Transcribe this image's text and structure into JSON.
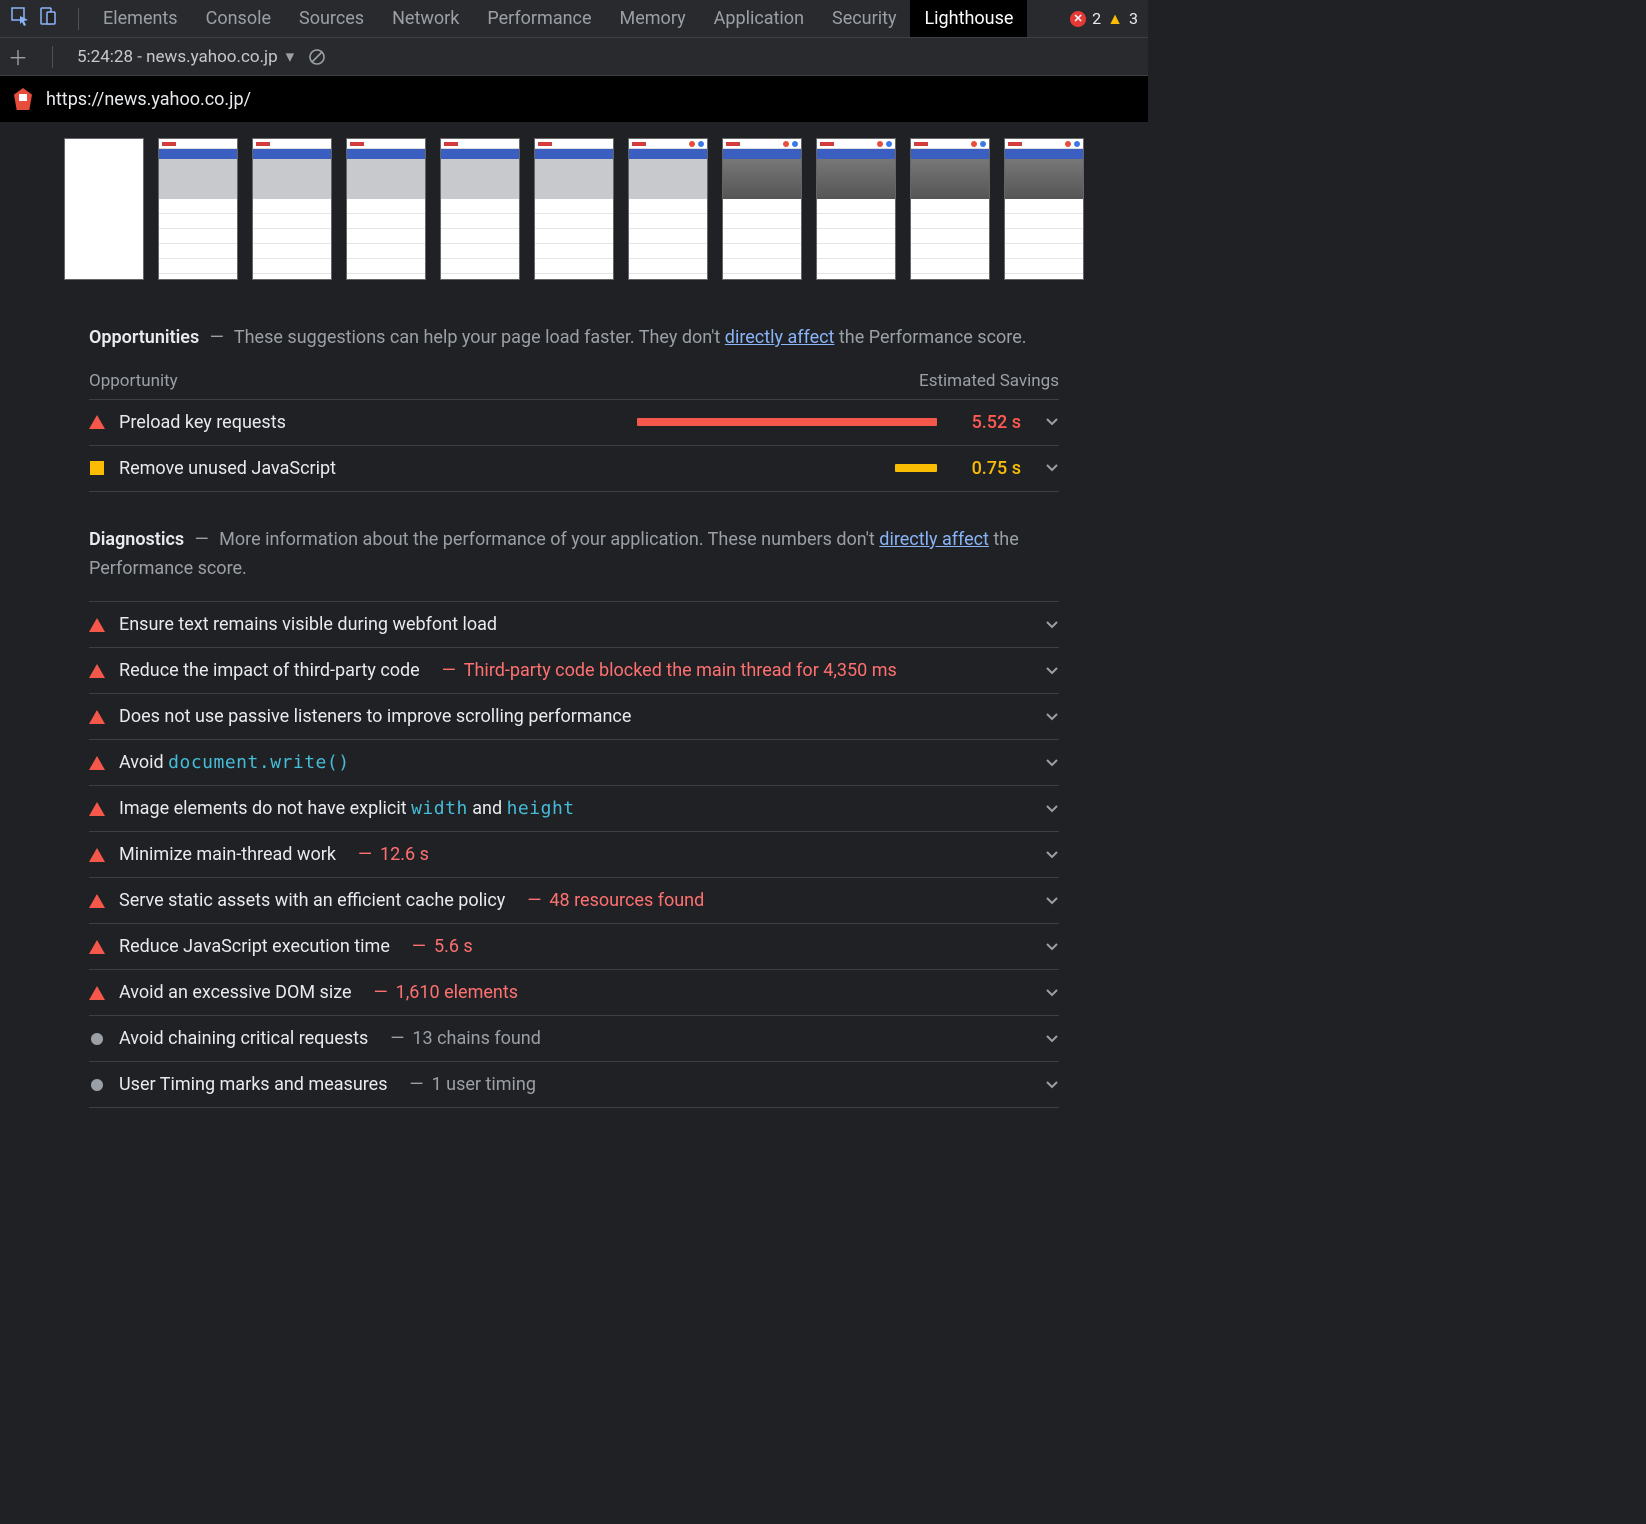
{
  "tabs": [
    "Elements",
    "Console",
    "Sources",
    "Network",
    "Performance",
    "Memory",
    "Application",
    "Security",
    "Lighthouse"
  ],
  "active_tab": "Lighthouse",
  "status": {
    "errors": "2",
    "warnings": "3"
  },
  "run": {
    "label": "5:24:28 - news.yahoo.co.jp"
  },
  "url": "https://news.yahoo.co.jp/",
  "opportunities": {
    "title": "Opportunities",
    "desc_pre": "These suggestions can help your page load faster. They don't ",
    "desc_link": "directly affect",
    "desc_post": " the Performance score.",
    "col1": "Opportunity",
    "col2": "Estimated Savings",
    "items": [
      {
        "sev": "red",
        "title": "Preload key requests",
        "bar_pct": 100,
        "val": "5.52 s"
      },
      {
        "sev": "yellow",
        "title": "Remove unused JavaScript",
        "bar_pct": 14,
        "val": "0.75 s"
      }
    ]
  },
  "diagnostics": {
    "title": "Diagnostics",
    "desc_pre": "More information about the performance of your application. These numbers don't ",
    "desc_link": "directly affect",
    "desc_post": " the Performance score.",
    "items": [
      {
        "sev": "red",
        "title": "Ensure text remains visible during webfont load"
      },
      {
        "sev": "red",
        "title": "Reduce the impact of third-party code",
        "detail": "Third-party code blocked the main thread for 4,350 ms",
        "detail_kind": "red"
      },
      {
        "sev": "red",
        "title": "Does not use passive listeners to improve scrolling performance"
      },
      {
        "sev": "red",
        "title_pre": "Avoid ",
        "code": "document.write()"
      },
      {
        "sev": "red",
        "title_pre": "Image elements do not have explicit ",
        "code": "width",
        "title_mid": " and ",
        "code2": "height"
      },
      {
        "sev": "red",
        "title": "Minimize main-thread work",
        "detail": "12.6 s",
        "detail_kind": "red"
      },
      {
        "sev": "red",
        "title": "Serve static assets with an efficient cache policy",
        "detail": "48 resources found",
        "detail_kind": "red"
      },
      {
        "sev": "red",
        "title": "Reduce JavaScript execution time",
        "detail": "5.6 s",
        "detail_kind": "red"
      },
      {
        "sev": "red",
        "title": "Avoid an excessive DOM size",
        "detail": "1,610 elements",
        "detail_kind": "red"
      },
      {
        "sev": "gray",
        "title": "Avoid chaining critical requests",
        "detail": "13 chains found",
        "detail_kind": "gray"
      },
      {
        "sev": "gray",
        "title": "User Timing marks and measures",
        "detail": "1 user timing",
        "detail_kind": "gray"
      }
    ]
  }
}
